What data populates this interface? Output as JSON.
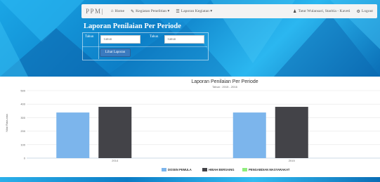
{
  "navbar": {
    "brand": "PPM|",
    "items": [
      {
        "label": "Home",
        "icon": "home-icon"
      },
      {
        "label": "Kegiatan Penelitian ▾",
        "icon": "pencil-icon"
      },
      {
        "label": "Laporan Kegiatan ▾",
        "icon": "list-icon"
      }
    ],
    "user": "Tatut Wulansari, Staritia - Kaveti",
    "logout": "Logout"
  },
  "page": {
    "title": "Laporan Penilaian Per Periode",
    "form": {
      "label_from": "Tahun",
      "placeholder_from": "Tahun",
      "label_to": "Tahun",
      "placeholder_to": "Tahun",
      "submit": "Lihat Laporan"
    }
  },
  "chart_data": {
    "type": "bar",
    "title": "Laporan Penilaian Per Periode",
    "subtitle": "Tahun : 2015 - 2016",
    "ylabel": "Nilai Rata-rata",
    "xlabel": "",
    "ylim": [
      0,
      500
    ],
    "yticks": [
      0,
      100,
      200,
      300,
      400,
      500
    ],
    "categories": [
      "2014",
      "2015"
    ],
    "series": [
      {
        "name": "DOSEN PEMULA",
        "color": "#7cb5ec",
        "values": [
          338,
          338
        ]
      },
      {
        "name": "HIBAH BERSAING",
        "color": "#434348",
        "values": [
          380,
          380
        ]
      },
      {
        "name": "PENGABDIAN MASYARAKAT",
        "color": "#90ed7d",
        "values": [
          0,
          0
        ]
      }
    ],
    "legend": "bottom-center",
    "grid": true
  }
}
